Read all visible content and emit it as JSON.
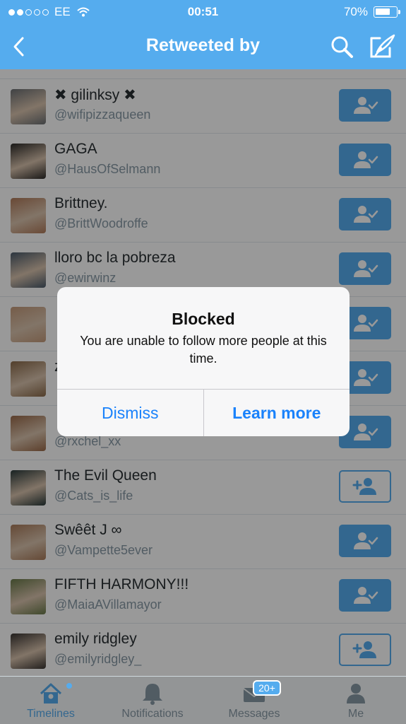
{
  "status_bar": {
    "carrier": "EE",
    "time": "00:51",
    "battery": "70%",
    "battery_level": 0.7
  },
  "header": {
    "title": "Retweeted by"
  },
  "users": [
    {
      "name": "✖ gilinksy ✖",
      "handle": "@wifipizzaqueen",
      "following": true,
      "avatar_color": "#6b6f73"
    },
    {
      "name": "GAGA",
      "handle": "@HausOfSelmann",
      "following": true,
      "avatar_color": "#2c2a28"
    },
    {
      "name": "Brittney.",
      "handle": "@BrittWoodroffe",
      "following": true,
      "avatar_color": "#b07a5a"
    },
    {
      "name": "lloro bc la pobreza",
      "handle": "@ewirwinz",
      "following": true,
      "avatar_color": "#4a5a6a"
    },
    {
      "name": "",
      "handle": "",
      "following": true,
      "avatar_color": "#c49a7a"
    },
    {
      "name": "z",
      "handle": "",
      "following": true,
      "avatar_color": "#8a6a4a"
    },
    {
      "name": "",
      "handle": "@rxchel_xx",
      "following": true,
      "avatar_color": "#9a6a4a"
    },
    {
      "name": "The Evil Queen",
      "handle": "@Cats_is_life",
      "following": false,
      "avatar_color": "#2a3a3a"
    },
    {
      "name": "Swêêt J ∞",
      "handle": "@Vampette5ever",
      "following": true,
      "avatar_color": "#a87a5a"
    },
    {
      "name": "FIFTH HARMONY!!!",
      "handle": "@MaiaAVillamayor",
      "following": true,
      "avatar_color": "#6a7a4a"
    },
    {
      "name": "emily ridgley",
      "handle": "@emilyridgley_",
      "following": false,
      "avatar_color": "#3a3532"
    }
  ],
  "alert": {
    "title": "Blocked",
    "message": "You are unable to follow more people at this time.",
    "dismiss": "Dismiss",
    "learn_more": "Learn more"
  },
  "tabs": {
    "timelines": "Timelines",
    "notifications": "Notifications",
    "messages": "Messages",
    "messages_badge": "20+",
    "me": "Me"
  },
  "colors": {
    "brand": "#55acee",
    "ios_blue": "#1a82fb"
  }
}
